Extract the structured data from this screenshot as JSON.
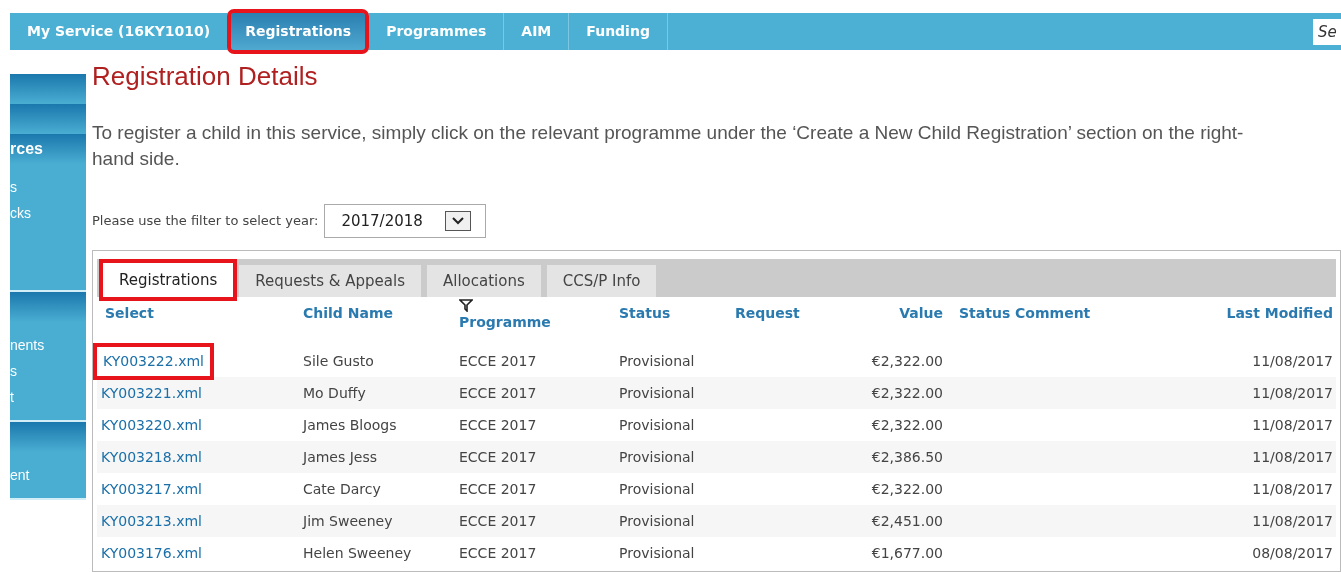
{
  "nav": {
    "items": [
      {
        "label": "My Service (16KY1010)",
        "selected": false,
        "highlighted": false
      },
      {
        "label": "Registrations",
        "selected": true,
        "highlighted": true
      },
      {
        "label": "Programmes",
        "selected": false,
        "highlighted": false
      },
      {
        "label": "AIM",
        "selected": false,
        "highlighted": false
      },
      {
        "label": "Funding",
        "selected": false,
        "highlighted": false
      }
    ],
    "search": {
      "placeholder": "Se"
    }
  },
  "sidebar": {
    "sections": [
      {
        "bar": true
      },
      {
        "bar": true
      },
      {
        "header": "rces",
        "items": [
          "s",
          "cks"
        ]
      },
      {
        "items": [
          "nents",
          "s",
          "t"
        ]
      },
      {
        "items": [
          "ent"
        ]
      }
    ]
  },
  "title": "Registration Details",
  "intro": "To register a child in this service, simply click on the relevant programme under the ‘Create a New Child Registration’ section on the right-hand side.",
  "filter": {
    "label": "Please use the filter to select year:",
    "value": "2017/2018"
  },
  "tabs": [
    {
      "label": "Registrations",
      "selected": true,
      "highlighted": true
    },
    {
      "label": "Requests & Appeals",
      "selected": false,
      "highlighted": false
    },
    {
      "label": "Allocations",
      "selected": false,
      "highlighted": false
    },
    {
      "label": "CCS/P Info",
      "selected": false,
      "highlighted": false
    }
  ],
  "table": {
    "columns": [
      {
        "label": "Select",
        "filter": false
      },
      {
        "label": "Child Name",
        "filter": false
      },
      {
        "label": "Programme",
        "filter": true
      },
      {
        "label": "Status",
        "filter": false
      },
      {
        "label": "Request",
        "filter": false
      },
      {
        "label": "Value",
        "filter": false
      },
      {
        "label": "Status Comment",
        "filter": false
      },
      {
        "label": "Last Modified",
        "filter": false
      }
    ],
    "rows": [
      {
        "select": "KY003222.xml",
        "highlighted": true,
        "child_name": "Sile Gusto",
        "programme": "ECCE 2017",
        "status": "Provisional",
        "value": "€2,322.00",
        "last_modified": "11/08/2017"
      },
      {
        "select": "KY003221.xml",
        "highlighted": false,
        "child_name": "Mo Duffy",
        "programme": "ECCE 2017",
        "status": "Provisional",
        "value": "€2,322.00",
        "last_modified": "11/08/2017"
      },
      {
        "select": "KY003220.xml",
        "highlighted": false,
        "child_name": "James Bloogs",
        "programme": "ECCE 2017",
        "status": "Provisional",
        "value": "€2,322.00",
        "last_modified": "11/08/2017"
      },
      {
        "select": "KY003218.xml",
        "highlighted": false,
        "child_name": "James Jess",
        "programme": "ECCE 2017",
        "status": "Provisional",
        "value": "€2,386.50",
        "last_modified": "11/08/2017"
      },
      {
        "select": "KY003217.xml",
        "highlighted": false,
        "child_name": "Cate Darcy",
        "programme": "ECCE 2017",
        "status": "Provisional",
        "value": "€2,322.00",
        "last_modified": "11/08/2017"
      },
      {
        "select": "KY003213.xml",
        "highlighted": false,
        "child_name": "Jim Sweeney",
        "programme": "ECCE 2017",
        "status": "Provisional",
        "value": "€2,451.00",
        "last_modified": "11/08/2017"
      },
      {
        "select": "KY003176.xml",
        "highlighted": false,
        "child_name": "Helen Sweeney",
        "programme": "ECCE 2017",
        "status": "Provisional",
        "value": "€1,677.00",
        "last_modified": "08/08/2017"
      }
    ]
  }
}
